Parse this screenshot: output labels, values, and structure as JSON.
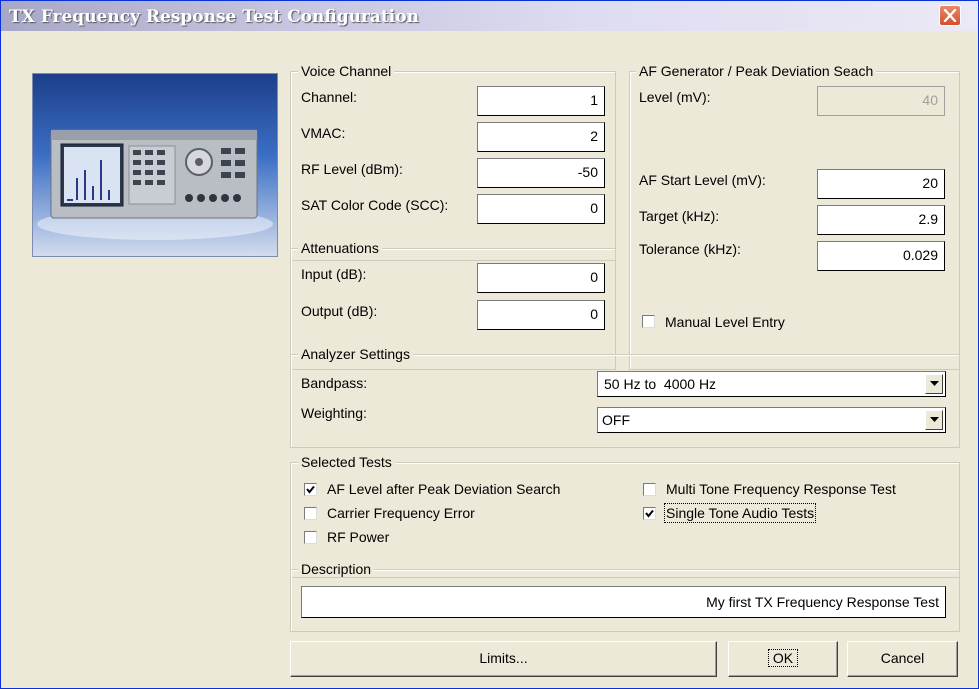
{
  "window": {
    "title": "TX Frequency Response Test Configuration"
  },
  "icons": {
    "close": "close-x-icon",
    "dropdown": "chevron-down-icon",
    "check": "checkmark-icon"
  },
  "voice_channel": {
    "title": "Voice Channel",
    "channel_label": "Channel:",
    "channel_value": "1",
    "vmac_label": "VMAC:",
    "vmac_value": "2",
    "rf_level_label": "RF Level (dBm):",
    "rf_level_value": "-50",
    "scc_label": "SAT Color Code (SCC):",
    "scc_value": "0"
  },
  "attenuations": {
    "title": "Attenuations",
    "input_label": "Input (dB):",
    "input_value": "0",
    "output_label": "Output (dB):",
    "output_value": "0"
  },
  "af_generator": {
    "title": "AF Generator / Peak Deviation Seach",
    "level_label": "Level (mV):",
    "level_value": "40",
    "start_level_label": "AF Start Level (mV):",
    "start_level_value": "20",
    "target_label": "Target (kHz):",
    "target_value": "2.9",
    "tolerance_label": "Tolerance (kHz):",
    "tolerance_value": "0.029",
    "manual_label": "Manual Level Entry",
    "manual_checked": false
  },
  "analyzer": {
    "title": "Analyzer Settings",
    "bandpass_label": "Bandpass:",
    "bandpass_value": "50 Hz to  4000 Hz",
    "weighting_label": "Weighting:",
    "weighting_value": "OFF"
  },
  "selected_tests": {
    "title": "Selected Tests",
    "af_level": {
      "label": "AF Level after Peak Deviation Search",
      "checked": true
    },
    "carrier": {
      "label": "Carrier Frequency Error",
      "checked": false
    },
    "rf_power": {
      "label": "RF Power",
      "checked": false
    },
    "multi_tone": {
      "label": "Multi Tone Frequency Response Test",
      "checked": false
    },
    "single_tone": {
      "label": "Single Tone Audio Tests",
      "checked": true
    }
  },
  "description": {
    "title": "Description",
    "value": "My first TX Frequency  Response Test"
  },
  "buttons": {
    "limits": "Limits...",
    "ok": "OK",
    "cancel": "Cancel"
  }
}
